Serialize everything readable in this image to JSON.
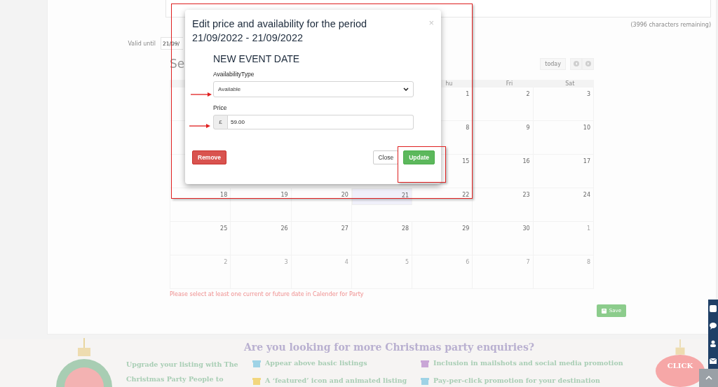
{
  "background": {
    "character_counter": "(3996 characters remaining)",
    "valid_until": {
      "label": "Valid until",
      "value": "21/09/"
    },
    "calendar": {
      "title": "Se",
      "today_button": "today",
      "weekdays": [
        "hu",
        "Fri",
        "Sat"
      ],
      "weeks": [
        [
          {
            "day": "1",
            "other_month": false,
            "today": false
          },
          {
            "day": "2",
            "other_month": false,
            "today": false
          },
          {
            "day": "3",
            "other_month": false,
            "today": false
          }
        ],
        [
          {
            "day": "8",
            "other_month": false,
            "today": false
          },
          {
            "day": "9",
            "other_month": false,
            "today": false
          },
          {
            "day": "10",
            "other_month": false,
            "today": false
          }
        ],
        [
          {
            "day": "15",
            "other_month": false,
            "today": false
          },
          {
            "day": "16",
            "other_month": false,
            "today": false
          },
          {
            "day": "17",
            "other_month": false,
            "today": false
          }
        ],
        [
          {
            "day": "18",
            "other_month": false,
            "today": false
          },
          {
            "day": "19",
            "other_month": false,
            "today": false
          },
          {
            "day": "20",
            "other_month": false,
            "today": false
          },
          {
            "day": "21",
            "other_month": false,
            "today": true
          },
          {
            "day": "22",
            "other_month": false,
            "today": false
          },
          {
            "day": "23",
            "other_month": false,
            "today": false
          },
          {
            "day": "24",
            "other_month": false,
            "today": false
          }
        ],
        [
          {
            "day": "25",
            "other_month": false,
            "today": false
          },
          {
            "day": "26",
            "other_month": false,
            "today": false
          },
          {
            "day": "27",
            "other_month": false,
            "today": false
          },
          {
            "day": "28",
            "other_month": false,
            "today": false
          },
          {
            "day": "29",
            "other_month": false,
            "today": false
          },
          {
            "day": "30",
            "other_month": false,
            "today": false
          },
          {
            "day": "1",
            "other_month": true,
            "today": false
          }
        ],
        [
          {
            "day": "2",
            "other_month": true,
            "today": false
          },
          {
            "day": "3",
            "other_month": true,
            "today": false
          },
          {
            "day": "4",
            "other_month": true,
            "today": false
          },
          {
            "day": "5",
            "other_month": true,
            "today": false
          },
          {
            "day": "6",
            "other_month": true,
            "today": false
          },
          {
            "day": "7",
            "other_month": true,
            "today": false
          },
          {
            "day": "8",
            "other_month": true,
            "today": false
          }
        ]
      ]
    },
    "error": "Please select at least one current or future date in Calender for Party",
    "save_button": "Save"
  },
  "modal": {
    "title": "Edit price and availability for the period 21/09/2022 - 21/09/2022",
    "close": "×",
    "heading": "NEW EVENT DATE",
    "availability": {
      "label": "AvailabilityType",
      "value": "Available"
    },
    "price": {
      "label": "Price",
      "currency": "£",
      "value": "59.00"
    },
    "buttons": {
      "remove": "Remove",
      "close": "Close",
      "update": "Update"
    }
  },
  "promo": {
    "title": "Are you looking for more Christmas party enquiries?",
    "intro": "Upgrade your listing with The Christmas Party People to",
    "features": [
      {
        "text": "Appear above basic listings",
        "color": "#9fd3e6"
      },
      {
        "text": "Inclusion in mailshots and social media promotion",
        "color": "#c9a6d6"
      },
      {
        "text": "A ‘featured’ icon and animated listing",
        "color": "#f2d67e"
      },
      {
        "text": "Pay-per-click promotion for your destination",
        "color": "#9fd3e6"
      }
    ],
    "click_badge": "CLICK"
  }
}
